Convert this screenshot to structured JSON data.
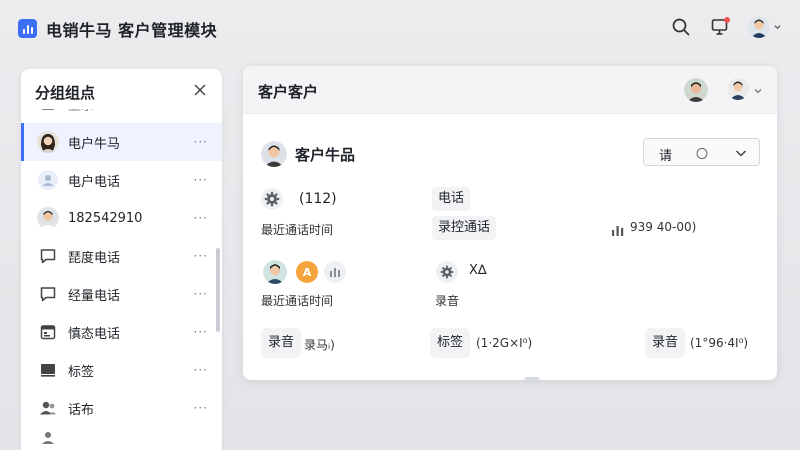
{
  "app": {
    "title": "电销牛马 客户管理模块"
  },
  "topbar": {
    "icons": [
      "search-icon",
      "monitor-icon",
      "user-avatar"
    ]
  },
  "sidebar": {
    "title": "分组组点",
    "items": [
      {
        "label": "显示",
        "icon": "contact-card-icon"
      },
      {
        "label": "电户牛马",
        "icon": "avatar-female",
        "active": true
      },
      {
        "label": "电户电话",
        "icon": "person-icon"
      },
      {
        "label": "182542910",
        "icon": "avatar-male"
      },
      {
        "label": "琵度电话",
        "icon": "chat-icon"
      },
      {
        "label": "经量电话",
        "icon": "chat-icon"
      },
      {
        "label": "慎态电话",
        "icon": "calendar-icon"
      },
      {
        "label": "标签",
        "icon": "tag-icon"
      },
      {
        "label": "话布",
        "icon": "people-icon"
      }
    ]
  },
  "card": {
    "title": "客户客户",
    "customer_name": "客户牛品",
    "select": {
      "value": "请",
      "mark": "〇"
    },
    "count_text": "(112)",
    "recent_call_label_1": "最近通话时间",
    "phone_chip": "电话",
    "record_chip": "录控通话",
    "stat_text": "939 40-00)",
    "badge_text": "A",
    "mute_text": "X∆",
    "recent_call_label_2": "最近通话时间",
    "recording_label": "录音",
    "btn1": {
      "label": "录音",
      "trail": "录马ᵢ)"
    },
    "btn2": {
      "label": "标签",
      "trail": "(1·2G×I⁰)"
    },
    "btn3": {
      "label": "录音",
      "trail": "(1°96·4I⁰)"
    }
  },
  "colors": {
    "accent": "#3d6ff6",
    "notification": "#f0544f"
  }
}
